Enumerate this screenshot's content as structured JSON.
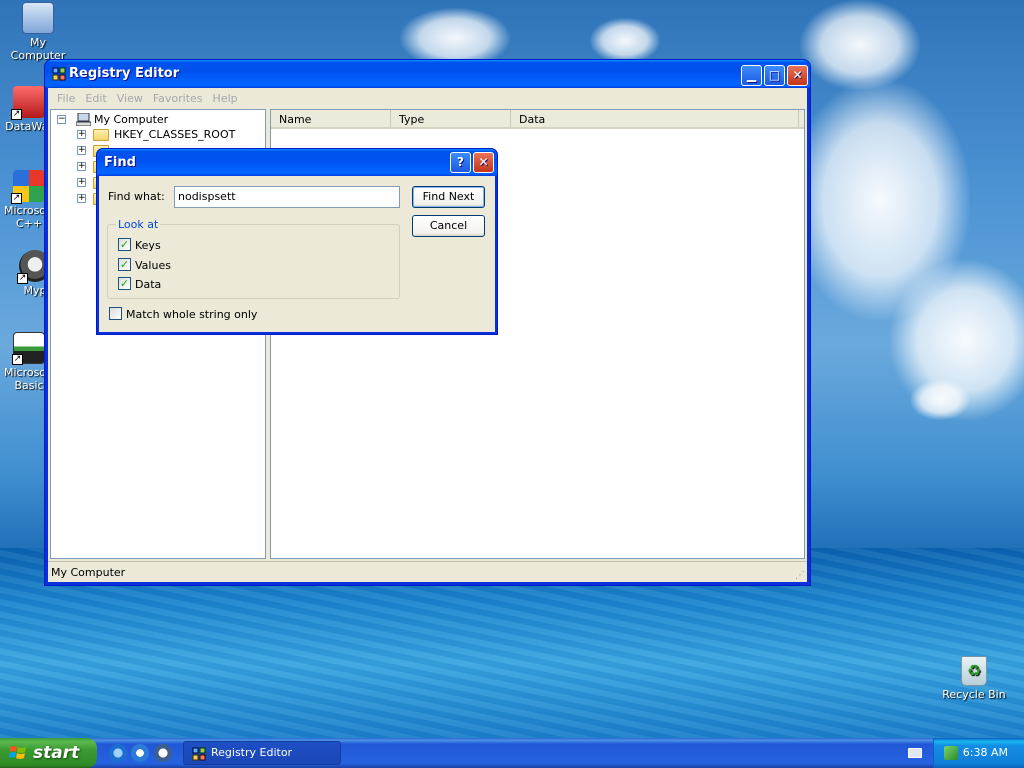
{
  "desktop": {
    "icons": [
      {
        "label": "My Computer"
      },
      {
        "label": "DataWar"
      },
      {
        "label": "Microsoft C++"
      },
      {
        "label": "Myp"
      },
      {
        "label": "Microsoft Basic"
      },
      {
        "label": "Recycle Bin"
      }
    ]
  },
  "window": {
    "title": "Registry Editor",
    "menu": [
      "File",
      "Edit",
      "View",
      "Favorites",
      "Help"
    ],
    "tree": {
      "root": "My Computer",
      "items": [
        "HKEY_CLASSES_ROOT"
      ]
    },
    "list_columns": [
      "Name",
      "Type",
      "Data"
    ],
    "status": "My Computer"
  },
  "find_dialog": {
    "title": "Find",
    "find_what_label": "Find what:",
    "find_what_value": "nodispsett",
    "find_next_label": "Find Next",
    "cancel_label": "Cancel",
    "look_at_label": "Look at",
    "keys_label": "Keys",
    "values_label": "Values",
    "data_label": "Data",
    "match_whole_label": "Match whole string only",
    "keys_checked": true,
    "values_checked": true,
    "data_checked": true,
    "match_whole_checked": false
  },
  "taskbar": {
    "start_label": "start",
    "task_label": "Registry Editor",
    "clock": "6:38 AM"
  },
  "colors": {
    "title_blue": "#0053ee",
    "dialog_face": "#ece9d8",
    "start_green": "#3b9a32"
  }
}
